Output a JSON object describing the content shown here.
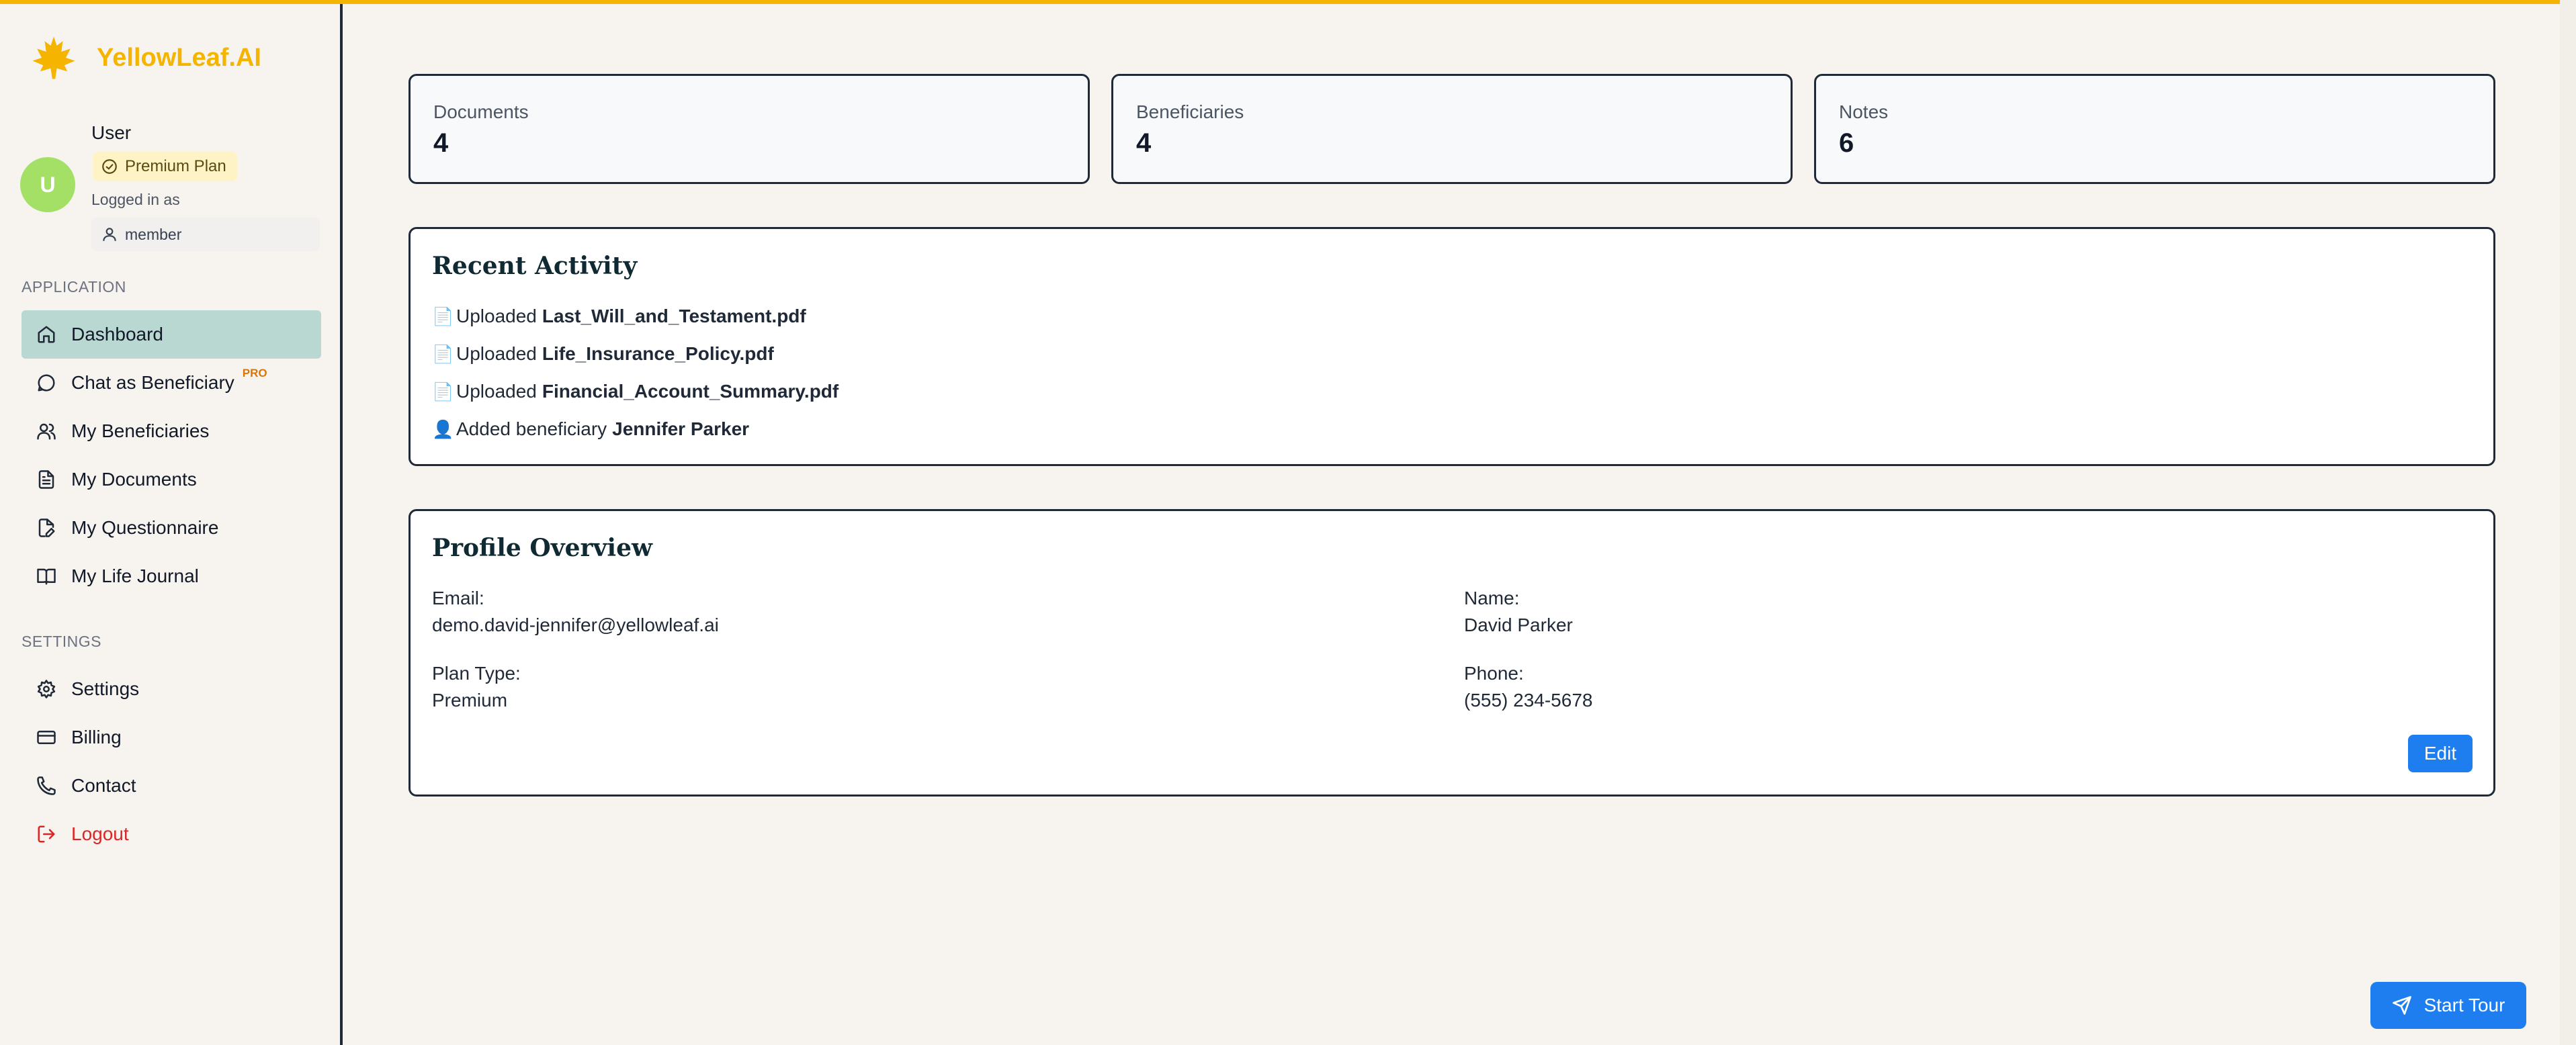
{
  "brand": {
    "name": "YellowLeaf.AI",
    "color": "#f5b400"
  },
  "user": {
    "initial": "U",
    "name": "User",
    "plan_badge": "Premium Plan",
    "logged_in_label": "Logged in as",
    "role": "member"
  },
  "sidebar": {
    "application_label": "APPLICATION",
    "settings_label": "SETTINGS",
    "app_items": [
      {
        "label": "Dashboard",
        "icon": "home-icon",
        "active": true
      },
      {
        "label": "Chat as Beneficiary",
        "icon": "chat-icon",
        "badge": "PRO"
      },
      {
        "label": "My Beneficiaries",
        "icon": "users-icon"
      },
      {
        "label": "My Documents",
        "icon": "document-icon"
      },
      {
        "label": "My Questionnaire",
        "icon": "file-edit-icon"
      },
      {
        "label": "My Life Journal",
        "icon": "book-icon"
      }
    ],
    "settings_items": [
      {
        "label": "Settings",
        "icon": "gear-icon"
      },
      {
        "label": "Billing",
        "icon": "credit-card-icon"
      },
      {
        "label": "Contact",
        "icon": "phone-icon"
      },
      {
        "label": "Logout",
        "icon": "logout-icon"
      }
    ]
  },
  "stats": [
    {
      "label": "Documents",
      "value": "4"
    },
    {
      "label": "Beneficiaries",
      "value": "4"
    },
    {
      "label": "Notes",
      "value": "6"
    }
  ],
  "recent_activity": {
    "title": "Recent Activity",
    "items": [
      {
        "icon": "document-icon",
        "action": "Uploaded",
        "subject": "Last_Will_and_Testament.pdf"
      },
      {
        "icon": "document-icon",
        "action": "Uploaded",
        "subject": "Life_Insurance_Policy.pdf"
      },
      {
        "icon": "document-icon",
        "action": "Uploaded",
        "subject": "Financial_Account_Summary.pdf"
      },
      {
        "icon": "person-icon",
        "action": "Added beneficiary",
        "subject": "Jennifer Parker"
      }
    ]
  },
  "profile": {
    "title": "Profile Overview",
    "email_label": "Email:",
    "email": "demo.david-jennifer@yellowleaf.ai",
    "name_label": "Name:",
    "name": "David Parker",
    "plan_label": "Plan Type:",
    "plan": "Premium",
    "phone_label": "Phone:",
    "phone": "(555) 234-5678",
    "edit_label": "Edit"
  },
  "tour_button": "Start Tour",
  "colors": {
    "accent": "#1e7ef0",
    "active_nav": "#b9d8d2",
    "logout": "#dc2626",
    "avatar": "#a3e065"
  }
}
